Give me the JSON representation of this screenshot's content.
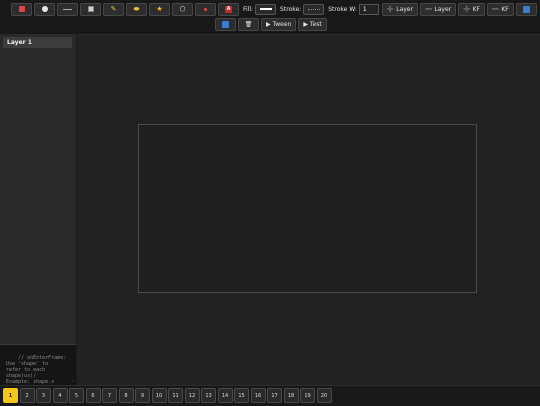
{
  "toolbar": {
    "tools": [
      {
        "name": "rectangle-tool",
        "icon": "red-square-icon"
      },
      {
        "name": "circle-tool",
        "icon": "circle-icon"
      },
      {
        "name": "line-tool",
        "icon": "line-icon"
      },
      {
        "name": "box-tool",
        "icon": "square-icon"
      },
      {
        "name": "pen-tool",
        "icon": "pencil-icon"
      },
      {
        "name": "eraser-tool",
        "icon": "eraser-icon"
      },
      {
        "name": "star-tool",
        "icon": "star-icon"
      },
      {
        "name": "polygon-tool",
        "icon": "hexagon-icon"
      },
      {
        "name": "point-tool",
        "icon": "dot-icon"
      },
      {
        "name": "text-tool",
        "icon": "text-icon",
        "glyph": "A"
      }
    ],
    "fill_label": "Fill:",
    "fill_color": "#ffffff",
    "stroke_label": "Stroke:",
    "stroke_width_label": "Stroke W:",
    "stroke_width_value": "1",
    "add_layer_label": "Layer",
    "remove_layer_label": "Layer",
    "add_kf_label": "KF",
    "remove_kf_label": "KF",
    "tween_label": "Tween",
    "test_label": "Test"
  },
  "sidebar": {
    "layers": [
      "Layer 1"
    ],
    "script_text": "// onEnterFrame:\nUse 'shape' to\nrefer to each\nshape(us)/\nExample: shape.x"
  },
  "timeline": {
    "frames": [
      "1",
      "2",
      "3",
      "4",
      "5",
      "6",
      "7",
      "8",
      "9",
      "10",
      "11",
      "12",
      "13",
      "14",
      "15",
      "16",
      "17",
      "18",
      "19",
      "20"
    ],
    "active_frame": "1"
  },
  "colors": {
    "accent": "#f5c518",
    "background": "#222222",
    "toolbar": "#181818",
    "sidebar": "#2a2a2a"
  }
}
